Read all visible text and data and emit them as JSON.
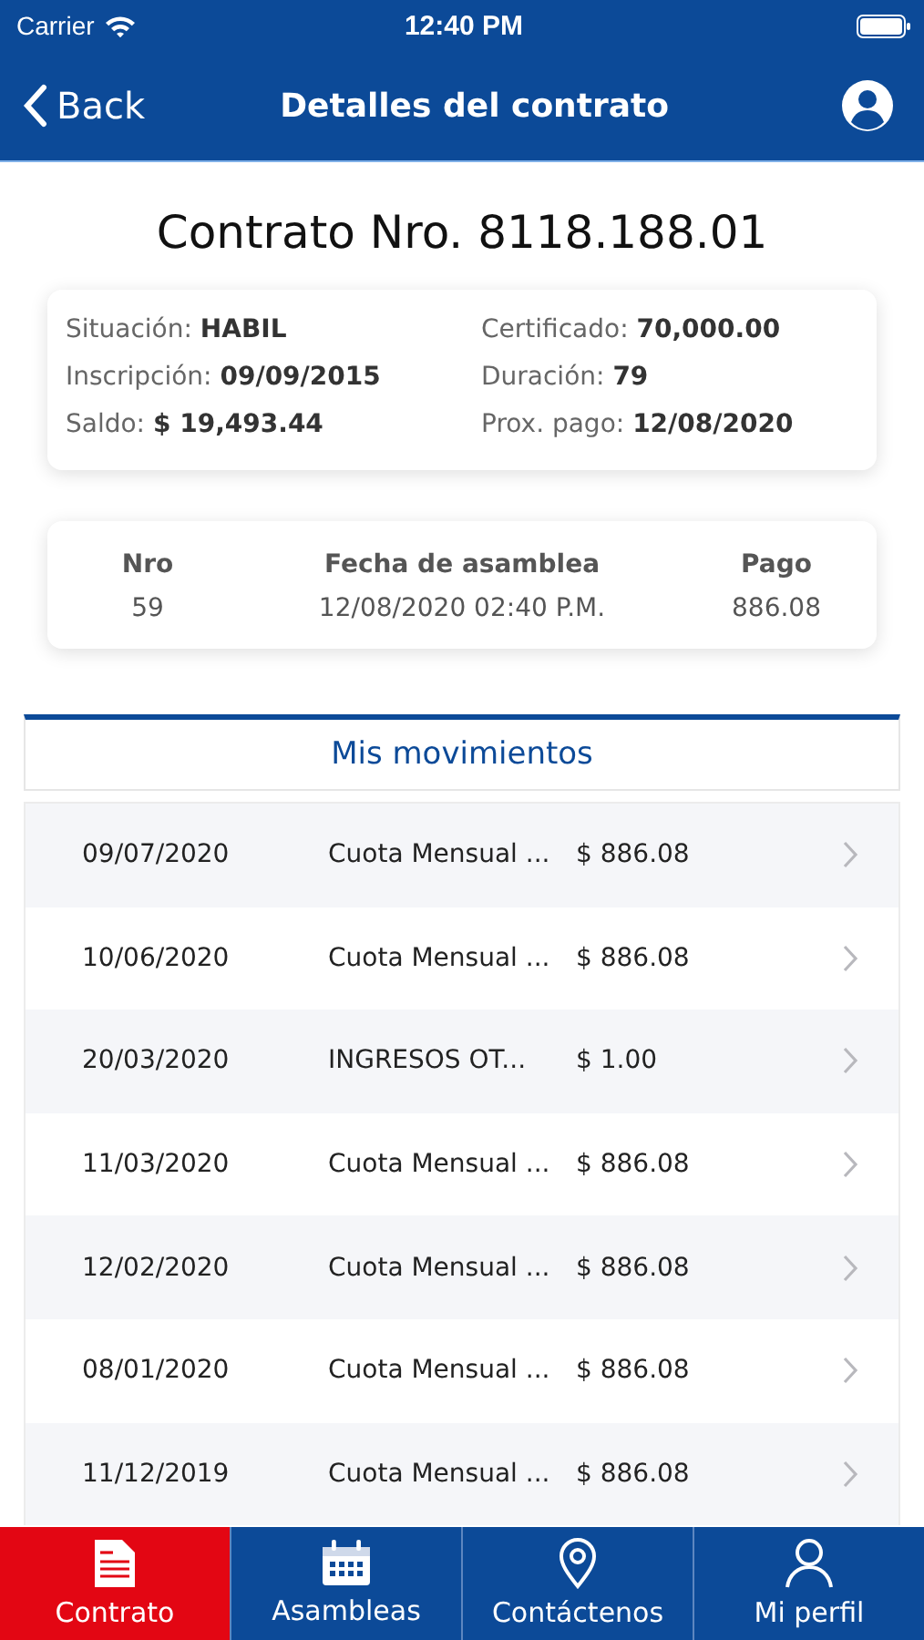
{
  "status_bar": {
    "carrier": "Carrier",
    "time": "12:40 PM"
  },
  "nav": {
    "back": "Back",
    "title": "Detalles del contrato"
  },
  "contract_title": "Contrato Nro. 8118.188.01",
  "details": [
    {
      "label": "Situación:",
      "value": "HABIL"
    },
    {
      "label": "Certificado:",
      "value": "70,000.00"
    },
    {
      "label": "Inscripción:",
      "value": "09/09/2015"
    },
    {
      "label": "Duración:",
      "value": "79"
    },
    {
      "label": "Saldo:",
      "value": "$ 19,493.44"
    },
    {
      "label": "Prox. pago:",
      "value": "12/08/2020"
    }
  ],
  "assembly": {
    "columns": [
      "Nro",
      "Fecha de asamblea",
      "Pago"
    ],
    "values": [
      "59",
      "12/08/2020 02:40 P.M.",
      "886.08"
    ]
  },
  "movements_title": "Mis movimientos",
  "movements": [
    {
      "date": "09/07/2020",
      "concept": "Cuota Mensual ...",
      "amount": "$ 886.08"
    },
    {
      "date": "10/06/2020",
      "concept": "Cuota Mensual ...",
      "amount": "$ 886.08"
    },
    {
      "date": "20/03/2020",
      "concept": "INGRESOS OT...",
      "amount": "$ 1.00"
    },
    {
      "date": "11/03/2020",
      "concept": "Cuota Mensual ...",
      "amount": "$ 886.08"
    },
    {
      "date": "12/02/2020",
      "concept": "Cuota Mensual ...",
      "amount": "$ 886.08"
    },
    {
      "date": "08/01/2020",
      "concept": "Cuota Mensual ...",
      "amount": "$ 886.08"
    },
    {
      "date": "11/12/2019",
      "concept": "Cuota Mensual ...",
      "amount": "$ 886.08"
    }
  ],
  "tabs": [
    {
      "label": "Contrato",
      "kind": "document",
      "selected": true
    },
    {
      "label": "Asambleas",
      "kind": "calendar",
      "selected": false
    },
    {
      "label": "Contáctenos",
      "kind": "pin",
      "selected": false
    },
    {
      "label": "Mi perfil",
      "kind": "person",
      "selected": false
    }
  ]
}
